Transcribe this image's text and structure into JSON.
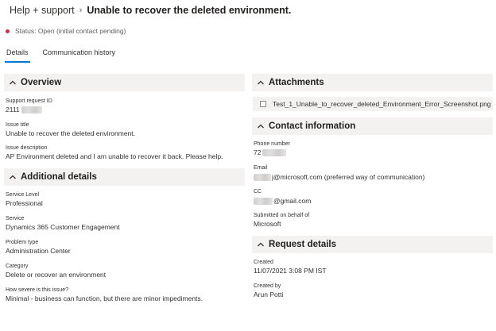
{
  "breadcrumb": {
    "parent": "Help + support",
    "separator": "›",
    "title": "Unable to recover the deleted environment."
  },
  "status": {
    "text": "Status: Open (initial contact pending)",
    "color": "#c4314b"
  },
  "tabs": [
    {
      "label": "Details",
      "active": true
    },
    {
      "label": "Communication history",
      "active": false
    }
  ],
  "overview": {
    "header": "Overview",
    "support_request_id_label": "Support request ID",
    "support_request_id_value": "2111",
    "issue_title_label": "Issue title",
    "issue_title_value": "Unable to recover the deleted environment.",
    "issue_description_label": "Issue description",
    "issue_description_value": "AP Environment deleted and I am unable to recover it back. Please help."
  },
  "additional_details": {
    "header": "Additional details",
    "service_level_label": "Service Level",
    "service_level_value": "Professional",
    "service_label": "Service",
    "service_value": "Dynamics 365 Customer Engagement",
    "problem_type_label": "Problem type",
    "problem_type_value": "Administration Center",
    "category_label": "Category",
    "category_value": "Delete or recover an environment",
    "severity_label": "How severe is this issue?",
    "severity_value": "Minimal - business can function, but there are minor impediments."
  },
  "attachments": {
    "header": "Attachments",
    "file_name": "Test_1_Unable_to_recover_deleted_Environment_Error_Screenshot.png"
  },
  "contact_information": {
    "header": "Contact information",
    "phone_label": "Phone number",
    "phone_value": "72",
    "email_label": "Email",
    "email_value": "j@microsoft.com (preferred way of communication)",
    "cc_label": "CC",
    "cc_value": "@gmail.com",
    "behalf_label": "Submitted on behalf of",
    "behalf_value": "Microsoft"
  },
  "request_details": {
    "header": "Request details",
    "created_label": "Created",
    "created_value": "11/07/2021 3:08 PM IST",
    "created_by_label": "Created by",
    "created_by_value": "Arun Potti"
  }
}
